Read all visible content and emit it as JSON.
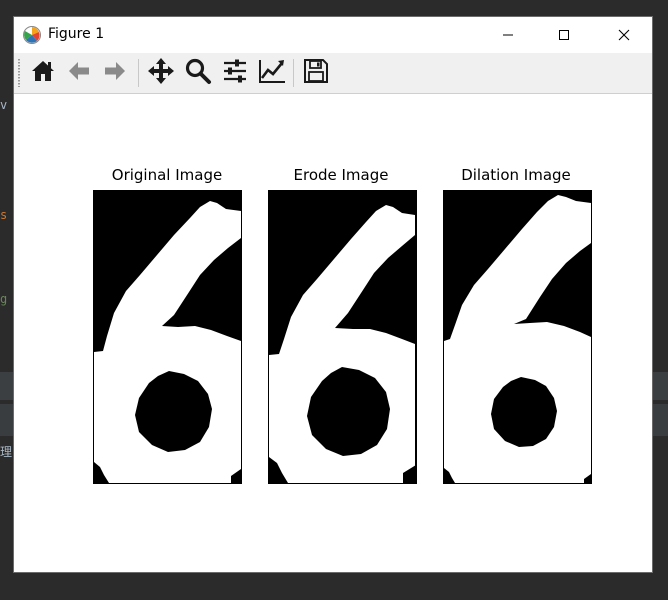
{
  "window": {
    "title": "Figure 1",
    "icon": "matplotlib-icon",
    "controls": [
      "minimize-icon",
      "maximize-icon",
      "close-icon"
    ]
  },
  "toolbar": {
    "buttons": [
      {
        "name": "home",
        "icon": "home-icon"
      },
      {
        "name": "back",
        "icon": "arrow-left-icon"
      },
      {
        "name": "forward",
        "icon": "arrow-right-icon"
      },
      {
        "name": "pan",
        "icon": "move-icon"
      },
      {
        "name": "zoom",
        "icon": "magnifier-icon"
      },
      {
        "name": "configure-subplots",
        "icon": "sliders-icon"
      },
      {
        "name": "edit-axes",
        "icon": "line-chart-icon"
      },
      {
        "name": "save",
        "icon": "floppy-disk-icon"
      }
    ]
  },
  "figure": {
    "subplots": [
      {
        "title": "Original Image"
      },
      {
        "title": "Erode Image"
      },
      {
        "title": "Dilation Image"
      }
    ],
    "colors": {
      "background": "#000000",
      "foreground": "#ffffff"
    }
  },
  "ide_background": {
    "fragments": [
      "v",
      "s",
      "g",
      "理"
    ]
  }
}
